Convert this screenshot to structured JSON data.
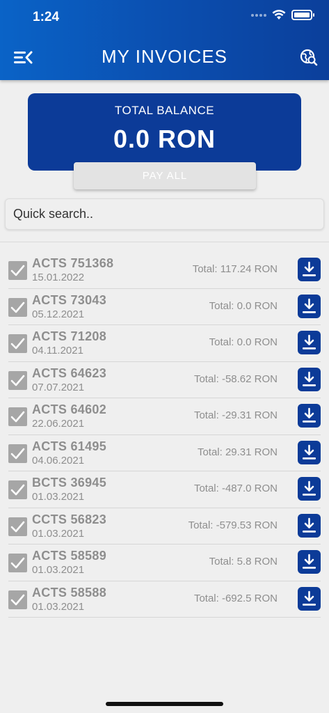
{
  "status_bar": {
    "time": "1:24"
  },
  "header": {
    "title": "MY INVOICES",
    "menu_icon": "menu-back-icon",
    "action_icon": "globe-search-icon"
  },
  "balance": {
    "label": "TOTAL BALANCE",
    "value": "0.0 RON"
  },
  "pay_all_label": "PAY ALL",
  "search": {
    "placeholder": "Quick search..",
    "value": ""
  },
  "invoices": [
    {
      "id": "ACTS 751368",
      "date": "15.01.2022",
      "total": "Total: 117.24 RON"
    },
    {
      "id": "ACTS 73043",
      "date": "05.12.2021",
      "total": "Total: 0.0 RON"
    },
    {
      "id": "ACTS 71208",
      "date": "04.11.2021",
      "total": "Total: 0.0 RON"
    },
    {
      "id": "ACTS 64623",
      "date": "07.07.2021",
      "total": "Total: -58.62 RON"
    },
    {
      "id": "ACTS 64602",
      "date": "22.06.2021",
      "total": "Total: -29.31 RON"
    },
    {
      "id": "ACTS 61495",
      "date": "04.06.2021",
      "total": "Total: 29.31 RON"
    },
    {
      "id": "BCTS 36945",
      "date": "01.03.2021",
      "total": "Total: -487.0 RON"
    },
    {
      "id": "CCTS 56823",
      "date": "01.03.2021",
      "total": "Total: -579.53 RON"
    },
    {
      "id": "ACTS 58589",
      "date": "01.03.2021",
      "total": "Total: 5.8 RON"
    },
    {
      "id": "ACTS 58588",
      "date": "01.03.2021",
      "total": "Total: -692.5 RON"
    }
  ],
  "colors": {
    "header": "#0b4fb0",
    "card": "#0c3b98",
    "download": "#0c3b98",
    "checkbox": "#a6a6a6"
  }
}
